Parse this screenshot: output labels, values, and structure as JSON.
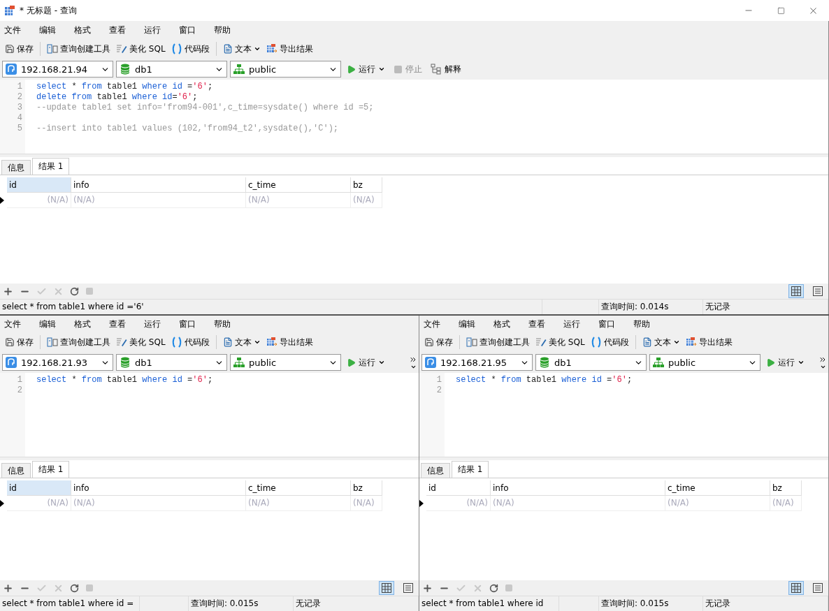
{
  "window": {
    "title": "* 无标题 - 查询"
  },
  "panes": [
    {
      "menu": [
        "文件",
        "编辑",
        "格式",
        "查看",
        "运行",
        "窗口",
        "帮助"
      ],
      "toolbar": [
        {
          "kind": "save",
          "label": "保存"
        },
        {
          "kind": "builder",
          "label": "查询创建工具"
        },
        {
          "kind": "beautify",
          "label": "美化 SQL"
        },
        {
          "kind": "snippet",
          "label": "代码段"
        },
        {
          "kind": "text",
          "label": "文本"
        },
        {
          "kind": "export",
          "label": "导出结果"
        }
      ],
      "connection": "192.168.21.94",
      "database": "db1",
      "schema": "public",
      "actions": [
        {
          "kind": "run",
          "label": "运行",
          "disabled": false
        },
        {
          "kind": "stop",
          "label": "停止",
          "disabled": true
        },
        {
          "kind": "explain",
          "label": "解释",
          "disabled": false
        }
      ],
      "more_button": false,
      "code": [
        {
          "number": "1",
          "tokens": [
            {
              "kind": "keyword",
              "text": "select"
            },
            {
              "kind": "plain",
              "text": " * "
            },
            {
              "kind": "keyword",
              "text": "from"
            },
            {
              "kind": "plain",
              "text": " table1 "
            },
            {
              "kind": "keyword",
              "text": "where id"
            },
            {
              "kind": "plain",
              "text": " ="
            },
            {
              "kind": "string",
              "text": "'6'"
            },
            {
              "kind": "plain",
              "text": ";"
            }
          ]
        },
        {
          "number": "2",
          "tokens": [
            {
              "kind": "keyword",
              "text": "delete from"
            },
            {
              "kind": "plain",
              "text": " table1 "
            },
            {
              "kind": "keyword",
              "text": "where id"
            },
            {
              "kind": "plain",
              "text": "="
            },
            {
              "kind": "string",
              "text": "'6'"
            },
            {
              "kind": "plain",
              "text": ";"
            }
          ]
        },
        {
          "number": "3",
          "tokens": [
            {
              "kind": "comment",
              "text": "--update table1 set info='from94-001',c_time=sysdate() where id =5;"
            }
          ]
        },
        {
          "number": "4"
        },
        {
          "number": "5",
          "tokens": [
            {
              "kind": "comment",
              "text": "--insert into table1 values (102,'from94_t2',sysdate(),'C');"
            }
          ]
        }
      ],
      "tabs": [
        {
          "label": "信息",
          "selected": false
        },
        {
          "label": "结果 1",
          "selected": true
        }
      ],
      "columns": [
        {
          "label": "id",
          "kind": "number",
          "selected": true
        },
        {
          "label": "info",
          "kind": "text",
          "selected": false
        },
        {
          "label": "c_time",
          "kind": "text",
          "selected": false
        },
        {
          "label": "bz",
          "kind": "text",
          "selected": false
        }
      ],
      "rows": [
        {
          "current": true,
          "cells": [
            "(N/A)",
            "(N/A)",
            "(N/A)",
            "(N/A)"
          ]
        }
      ],
      "grid_tools": [
        {
          "kind": "add",
          "disabled": false
        },
        {
          "kind": "delete",
          "disabled": false
        },
        {
          "kind": "apply",
          "disabled": true
        },
        {
          "kind": "discard",
          "disabled": true
        },
        {
          "kind": "refresh",
          "disabled": false
        },
        {
          "kind": "stop",
          "disabled": true
        }
      ],
      "views": [
        {
          "kind": "grid",
          "selected": true
        },
        {
          "kind": "form",
          "selected": false
        }
      ],
      "status": {
        "sql": "select * from table1 where id ='6'",
        "time": "查询时间: 0.014s",
        "records": "无记录"
      }
    },
    {
      "menu": [
        "文件",
        "编辑",
        "格式",
        "查看",
        "运行",
        "窗口",
        "帮助"
      ],
      "toolbar": [
        {
          "kind": "save",
          "label": "保存"
        },
        {
          "kind": "builder",
          "label": "查询创建工具"
        },
        {
          "kind": "beautify",
          "label": "美化 SQL"
        },
        {
          "kind": "snippet",
          "label": "代码段"
        },
        {
          "kind": "text",
          "label": "文本"
        },
        {
          "kind": "export",
          "label": "导出结果"
        }
      ],
      "connection": "192.168.21.93",
      "database": "db1",
      "schema": "public",
      "actions": [
        {
          "kind": "run",
          "label": "运行",
          "disabled": false
        }
      ],
      "more_button": true,
      "code": [
        {
          "number": "1",
          "tokens": [
            {
              "kind": "keyword",
              "text": "select"
            },
            {
              "kind": "plain",
              "text": " * "
            },
            {
              "kind": "keyword",
              "text": "from"
            },
            {
              "kind": "plain",
              "text": " table1 "
            },
            {
              "kind": "keyword",
              "text": "where id"
            },
            {
              "kind": "plain",
              "text": " ="
            },
            {
              "kind": "string",
              "text": "'6'"
            },
            {
              "kind": "plain",
              "text": ";"
            }
          ]
        },
        {
          "number": "2"
        }
      ],
      "tabs": [
        {
          "label": "信息",
          "selected": false
        },
        {
          "label": "结果 1",
          "selected": true
        }
      ],
      "columns": [
        {
          "label": "id",
          "kind": "number",
          "selected": true
        },
        {
          "label": "info",
          "kind": "text",
          "selected": false
        },
        {
          "label": "c_time",
          "kind": "text",
          "selected": false
        },
        {
          "label": "bz",
          "kind": "text",
          "selected": false
        }
      ],
      "rows": [
        {
          "current": true,
          "cells": [
            "(N/A)",
            "(N/A)",
            "(N/A)",
            "(N/A)"
          ]
        }
      ],
      "grid_tools": [
        {
          "kind": "add",
          "disabled": false
        },
        {
          "kind": "delete",
          "disabled": false
        },
        {
          "kind": "apply",
          "disabled": true
        },
        {
          "kind": "discard",
          "disabled": true
        },
        {
          "kind": "refresh",
          "disabled": false
        },
        {
          "kind": "stop",
          "disabled": true
        }
      ],
      "views": [
        {
          "kind": "grid",
          "selected": true
        },
        {
          "kind": "form",
          "selected": false
        }
      ],
      "status": {
        "sql": "select * from table1 where id =",
        "time": "查询时间: 0.015s",
        "records": "无记录"
      }
    },
    {
      "menu": [
        "文件",
        "编辑",
        "格式",
        "查看",
        "运行",
        "窗口",
        "帮助"
      ],
      "toolbar": [
        {
          "kind": "save",
          "label": "保存"
        },
        {
          "kind": "builder",
          "label": "查询创建工具"
        },
        {
          "kind": "beautify",
          "label": "美化 SQL"
        },
        {
          "kind": "snippet",
          "label": "代码段"
        },
        {
          "kind": "text",
          "label": "文本"
        },
        {
          "kind": "export",
          "label": "导出结果"
        }
      ],
      "connection": "192.168.21.95",
      "database": "db1",
      "schema": "public",
      "actions": [
        {
          "kind": "run",
          "label": "运行",
          "disabled": false
        }
      ],
      "more_button": true,
      "code": [
        {
          "number": "1",
          "tokens": [
            {
              "kind": "keyword",
              "text": "select"
            },
            {
              "kind": "plain",
              "text": " * "
            },
            {
              "kind": "keyword",
              "text": "from"
            },
            {
              "kind": "plain",
              "text": " table1 "
            },
            {
              "kind": "keyword",
              "text": "where id"
            },
            {
              "kind": "plain",
              "text": " ="
            },
            {
              "kind": "string",
              "text": "'6'"
            },
            {
              "kind": "plain",
              "text": ";"
            }
          ]
        },
        {
          "number": "2"
        }
      ],
      "tabs": [
        {
          "label": "信息",
          "selected": false
        },
        {
          "label": "结果 1",
          "selected": true
        }
      ],
      "columns": [
        {
          "label": "id",
          "kind": "number",
          "selected": false
        },
        {
          "label": "info",
          "kind": "text",
          "selected": false
        },
        {
          "label": "c_time",
          "kind": "text",
          "selected": false
        },
        {
          "label": "bz",
          "kind": "text",
          "selected": false
        }
      ],
      "rows": [
        {
          "current": true,
          "cells": [
            "(N/A)",
            "(N/A)",
            "(N/A)",
            "(N/A)"
          ]
        }
      ],
      "grid_tools": [
        {
          "kind": "add",
          "disabled": false
        },
        {
          "kind": "delete",
          "disabled": false
        },
        {
          "kind": "apply",
          "disabled": true
        },
        {
          "kind": "discard",
          "disabled": true
        },
        {
          "kind": "refresh",
          "disabled": false
        },
        {
          "kind": "stop",
          "disabled": true
        }
      ],
      "views": [
        {
          "kind": "grid",
          "selected": true
        },
        {
          "kind": "form",
          "selected": false
        }
      ],
      "status": {
        "sql": "select * from table1 where id",
        "time": "查询时间: 0.015s",
        "records": "无记录"
      }
    }
  ]
}
